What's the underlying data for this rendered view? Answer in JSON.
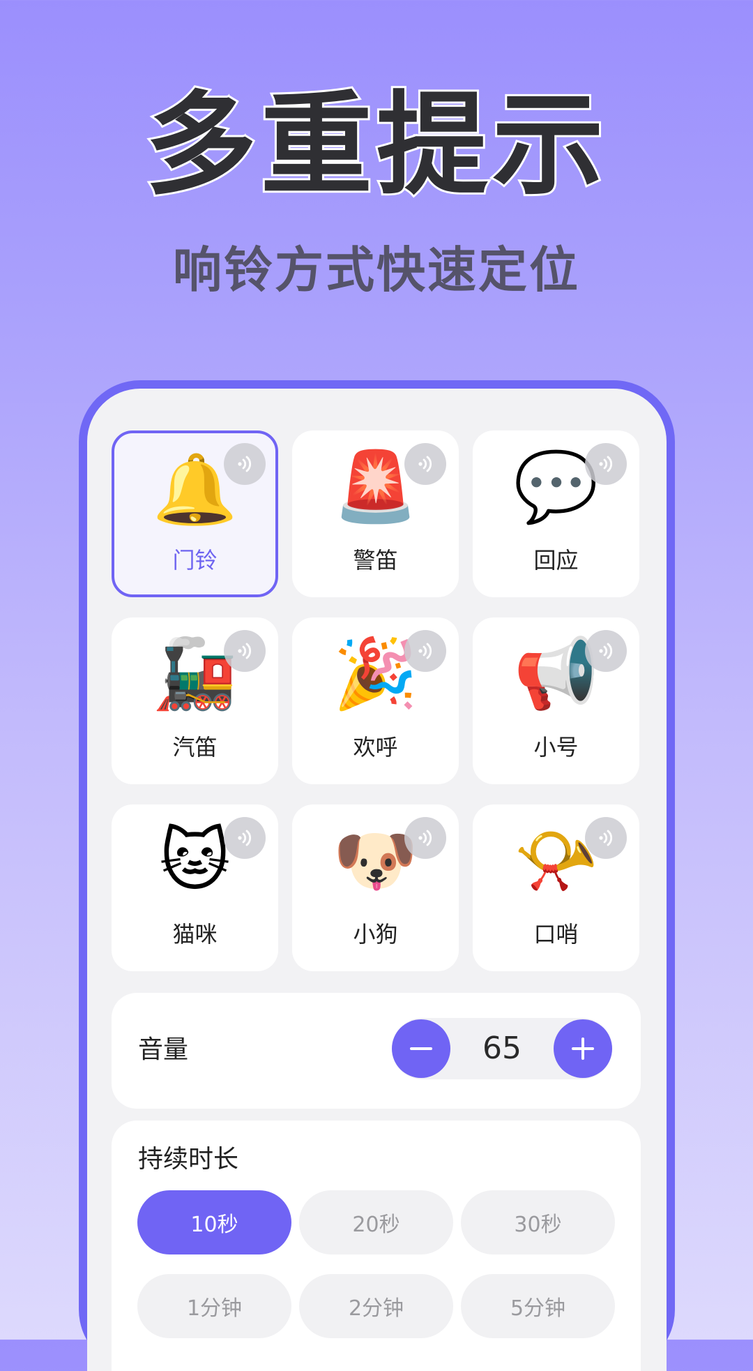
{
  "headline": "多重提示",
  "subline": "响铃方式快速定位",
  "sounds": [
    {
      "label": "门铃",
      "icon": "🔔",
      "icon_name": "bell-icon",
      "selected": true
    },
    {
      "label": "警笛",
      "icon": "🚨",
      "icon_name": "siren-icon",
      "selected": false
    },
    {
      "label": "回应",
      "icon": "💬",
      "icon_name": "chat-bubble-icon",
      "selected": false
    },
    {
      "label": "汽笛",
      "icon": "🚂",
      "icon_name": "train-icon",
      "selected": false
    },
    {
      "label": "欢呼",
      "icon": "🎉",
      "icon_name": "party-popper-icon",
      "selected": false
    },
    {
      "label": "小号",
      "icon": "📢",
      "icon_name": "megaphone-icon",
      "selected": false
    },
    {
      "label": "猫咪",
      "icon": "🐱",
      "icon_name": "cat-icon",
      "selected": false
    },
    {
      "label": "小狗",
      "icon": "🐶",
      "icon_name": "dog-icon",
      "selected": false
    },
    {
      "label": "口哨",
      "icon": "📯",
      "icon_name": "whistle-icon",
      "selected": false
    }
  ],
  "volume": {
    "label": "音量",
    "value": "65"
  },
  "duration": {
    "title": "持续时长",
    "options": [
      {
        "label": "10秒",
        "active": true
      },
      {
        "label": "20秒",
        "active": false
      },
      {
        "label": "30秒",
        "active": false
      },
      {
        "label": "1分钟",
        "active": false
      },
      {
        "label": "2分钟",
        "active": false
      },
      {
        "label": "5分钟",
        "active": false
      }
    ]
  },
  "colors": {
    "accent": "#7064f4",
    "frame": "#7068f5",
    "text": "#222222"
  }
}
